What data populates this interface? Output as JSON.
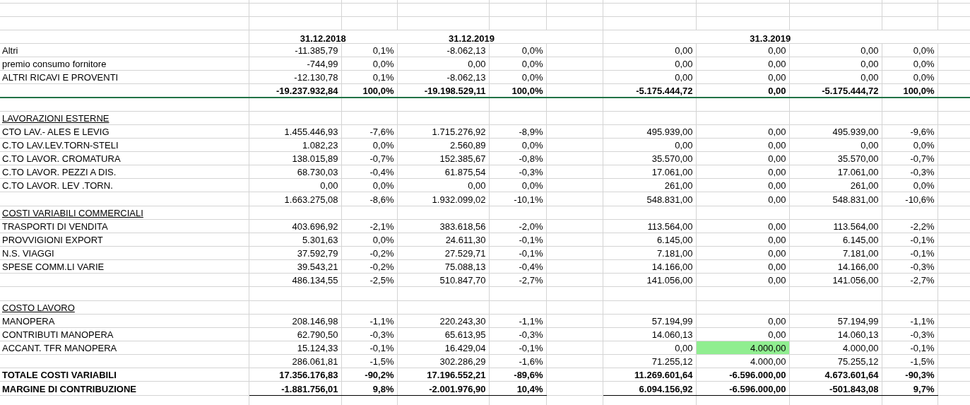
{
  "periods": [
    {
      "label": "31.12.2018"
    },
    {
      "label": "31.12.2019"
    },
    {
      "label": "31.3.2019"
    }
  ],
  "rows": [
    {
      "kind": "item",
      "label": "Altri",
      "cells": [
        "-11.385,79",
        "0,1%",
        "-8.062,13",
        "0,0%",
        "0,00",
        "0,00",
        "0,00",
        "0,0%"
      ]
    },
    {
      "kind": "item",
      "label": "premio consumo fornitore",
      "cells": [
        "-744,99",
        "0,0%",
        "0,00",
        "0,0%",
        "0,00",
        "0,00",
        "0,00",
        "0,0%"
      ]
    },
    {
      "kind": "subtotal",
      "label": "ALTRI RICAVI E PROVENTI",
      "cells": [
        "-12.130,78",
        "0,1%",
        "-8.062,13",
        "0,0%",
        "0,00",
        "0,00",
        "0,00",
        "0,0%"
      ]
    },
    {
      "kind": "section_total",
      "label": "",
      "cells": [
        "-19.237.932,84",
        "100,0%",
        "-19.198.529,11",
        "100,0%",
        "-5.175.444,72",
        "0,00",
        "-5.175.444,72",
        "100,0%"
      ]
    },
    {
      "kind": "blank",
      "label": "",
      "cells": []
    },
    {
      "kind": "heading",
      "label": "LAVORAZIONI ESTERNE",
      "cells": []
    },
    {
      "kind": "item",
      "label": "CTO LAV.- ALES E LEVIG",
      "cells": [
        "1.455.446,93",
        "-7,6%",
        "1.715.276,92",
        "-8,9%",
        "495.939,00",
        "0,00",
        "495.939,00",
        "-9,6%"
      ]
    },
    {
      "kind": "item",
      "label": "C.TO LAV.LEV.TORN-STELI",
      "cells": [
        "1.082,23",
        "0,0%",
        "2.560,89",
        "0,0%",
        "0,00",
        "0,00",
        "0,00",
        "0,0%"
      ]
    },
    {
      "kind": "item",
      "label": "C.TO LAVOR. CROMATURA",
      "cells": [
        "138.015,89",
        "-0,7%",
        "152.385,67",
        "-0,8%",
        "35.570,00",
        "0,00",
        "35.570,00",
        "-0,7%"
      ]
    },
    {
      "kind": "item",
      "label": "C.TO LAVOR. PEZZI A DIS.",
      "cells": [
        "68.730,03",
        "-0,4%",
        "61.875,54",
        "-0,3%",
        "17.061,00",
        "0,00",
        "17.061,00",
        "-0,3%"
      ]
    },
    {
      "kind": "item",
      "label": "C.TO LAVOR. LEV .TORN.",
      "cells": [
        "0,00",
        "0,0%",
        "0,00",
        "0,0%",
        "261,00",
        "0,00",
        "261,00",
        "0,0%"
      ]
    },
    {
      "kind": "subtotal",
      "label": "",
      "cells": [
        "1.663.275,08",
        "-8,6%",
        "1.932.099,02",
        "-10,1%",
        "548.831,00",
        "0,00",
        "548.831,00",
        "-10,6%"
      ]
    },
    {
      "kind": "heading",
      "label": "COSTI VARIABILI COMMERCIALI",
      "cells": []
    },
    {
      "kind": "item",
      "label": "TRASPORTI DI VENDITA",
      "cells": [
        "403.696,92",
        "-2,1%",
        "383.618,56",
        "-2,0%",
        "113.564,00",
        "0,00",
        "113.564,00",
        "-2,2%"
      ]
    },
    {
      "kind": "item",
      "label": "PROVVIGIONI EXPORT",
      "cells": [
        "5.301,63",
        "0,0%",
        "24.611,30",
        "-0,1%",
        "6.145,00",
        "0,00",
        "6.145,00",
        "-0,1%"
      ]
    },
    {
      "kind": "item",
      "label": "N.S. VIAGGI",
      "cells": [
        "37.592,79",
        "-0,2%",
        "27.529,71",
        "-0,1%",
        "7.181,00",
        "0,00",
        "7.181,00",
        "-0,1%"
      ]
    },
    {
      "kind": "item",
      "label": "SPESE COMM.LI VARIE",
      "cells": [
        "39.543,21",
        "-0,2%",
        "75.088,13",
        "-0,4%",
        "14.166,00",
        "0,00",
        "14.166,00",
        "-0,3%"
      ]
    },
    {
      "kind": "subtotal",
      "label": "",
      "cells": [
        "486.134,55",
        "-2,5%",
        "510.847,70",
        "-2,7%",
        "141.056,00",
        "0,00",
        "141.056,00",
        "-2,7%"
      ]
    },
    {
      "kind": "blank",
      "label": "",
      "cells": []
    },
    {
      "kind": "heading",
      "label": "COSTO LAVORO",
      "cells": []
    },
    {
      "kind": "item",
      "label": "MANOPERA",
      "cells": [
        "208.146,98",
        "-1,1%",
        "220.243,30",
        "-1,1%",
        "57.194,99",
        "0,00",
        "57.194,99",
        "-1,1%"
      ]
    },
    {
      "kind": "item",
      "label": "CONTRIBUTI MANOPERA",
      "cells": [
        "62.790,50",
        "-0,3%",
        "65.613,95",
        "-0,3%",
        "14.060,13",
        "0,00",
        "14.060,13",
        "-0,3%"
      ]
    },
    {
      "kind": "item",
      "label": "ACCANT. TFR MANOPERA",
      "cells": [
        "15.124,33",
        "-0,1%",
        "16.429,04",
        "-0,1%",
        "0,00",
        "4.000,00",
        "4.000,00",
        "-0,1%"
      ],
      "highlighted": [
        false,
        false,
        false,
        false,
        false,
        true,
        false,
        false
      ]
    },
    {
      "kind": "subtotal",
      "label": "",
      "cells": [
        "286.061,81",
        "-1,5%",
        "302.286,29",
        "-1,6%",
        "71.255,12",
        "4.000,00",
        "75.255,12",
        "-1,5%"
      ]
    },
    {
      "kind": "total",
      "label": "TOTALE COSTI VARIABILI",
      "cells": [
        "17.356.176,83",
        "-90,2%",
        "17.196.552,21",
        "-89,6%",
        "11.269.601,64",
        "-6.596.000,00",
        "4.673.601,64",
        "-90,3%"
      ]
    },
    {
      "kind": "result",
      "label": "MARGINE DI CONTRIBUZIONE",
      "cells": [
        "-1.881.756,01",
        "9,8%",
        "-2.001.976,90",
        "10,4%",
        "6.094.156,92",
        "-6.596.000,00",
        "-501.843,08",
        "9,7%"
      ]
    },
    {
      "kind": "blank",
      "label": "",
      "cells": []
    }
  ]
}
